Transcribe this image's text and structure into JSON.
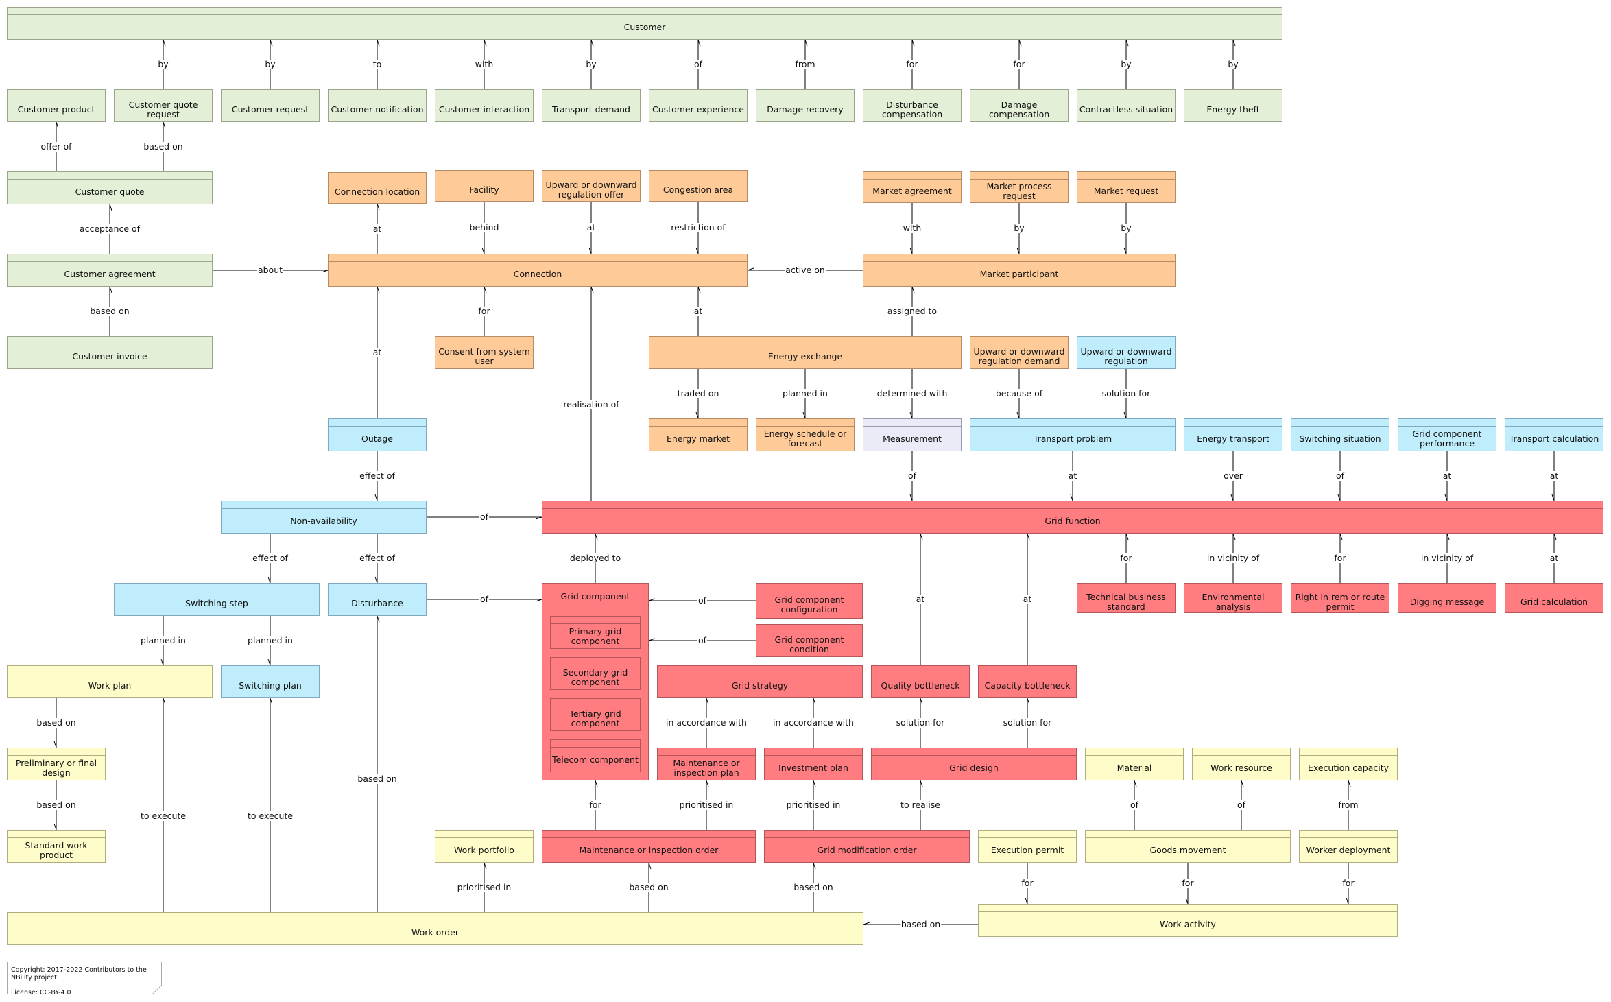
{
  "diagram": {
    "type": "NBility grid operator information model",
    "legend_colors": {
      "customer": "#e3efd6",
      "market": "#fecb98",
      "operations": "#bfedfb",
      "measurement": "#ebebf7",
      "grid": "#ff7d80",
      "work": "#fefdca"
    }
  },
  "entities": {
    "customer": "Customer",
    "customer_product": "Customer product",
    "customer_quote_request": "Customer quote request",
    "customer_request": "Customer request",
    "customer_notification": "Customer notification",
    "customer_interaction": "Customer interaction",
    "transport_demand": "Transport demand",
    "customer_experience": "Customer experience",
    "damage_recovery": "Damage recovery",
    "disturbance_compensation": "Disturbance compensation",
    "damage_compensation": "Damage compensation",
    "contractless_situation": "Contractless situation",
    "energy_theft": "Energy theft",
    "customer_quote": "Customer quote",
    "customer_agreement": "Customer agreement",
    "customer_invoice": "Customer invoice",
    "connection_location": "Connection location",
    "facility": "Facility",
    "regulation_offer": "Upward or downward regulation offer",
    "congestion_area": "Congestion area",
    "market_agreement": "Market agreement",
    "market_process_request": "Market process request",
    "market_request": "Market request",
    "connection": "Connection",
    "market_participant": "Market participant",
    "consent": "Consent from system user",
    "energy_exchange": "Energy exchange",
    "regulation_demand": "Upward or downward regulation demand",
    "regulation": "Upward or downward regulation",
    "outage": "Outage",
    "energy_market": "Energy market",
    "energy_schedule": "Energy schedule or forecast",
    "measurement": "Measurement",
    "transport_problem": "Transport problem",
    "energy_transport": "Energy transport",
    "switching_situation": "Switching situation",
    "grid_component_performance": "Grid component performance",
    "transport_calculation": "Transport calculation",
    "non_availability": "Non-availability",
    "grid_function": "Grid function",
    "switching_step": "Switching step",
    "disturbance": "Disturbance",
    "grid_component": "Grid component",
    "primary_grid_component": "Primary grid component",
    "secondary_grid_component": "Secondary grid component",
    "tertiary_grid_component": "Tertiary grid component",
    "telecom_component": "Telecom component",
    "grid_component_configuration": "Grid component configuration",
    "grid_component_condition": "Grid component condition",
    "technical_business_standard": "Technical business standard",
    "environmental_analysis": "Environmental analysis",
    "right_in_rem": "Right in rem or route permit",
    "digging_message": "Digging message",
    "grid_calculation": "Grid calculation",
    "work_plan": "Work plan",
    "switching_plan": "Switching plan",
    "grid_strategy": "Grid strategy",
    "quality_bottleneck": "Quality bottleneck",
    "capacity_bottleneck": "Capacity bottleneck",
    "preliminary_design": "Preliminary or final design",
    "maintenance_plan": "Maintenance or inspection plan",
    "investment_plan": "Investment plan",
    "grid_design": "Grid design",
    "material": "Material",
    "work_resource": "Work resource",
    "execution_capacity": "Execution capacity",
    "standard_work_product": "Standard work product",
    "work_portfolio": "Work portfolio",
    "maintenance_order": "Maintenance or inspection order",
    "grid_modification_order": "Grid modification order",
    "execution_permit": "Execution permit",
    "goods_movement": "Goods movement",
    "worker_deployment": "Worker deployment",
    "work_order": "Work order",
    "work_activity": "Work activity"
  },
  "relations": [
    {
      "from": "customer_quote_request",
      "to": "customer",
      "label": "by"
    },
    {
      "from": "customer_request",
      "to": "customer",
      "label": "by"
    },
    {
      "from": "customer_notification",
      "to": "customer",
      "label": "to"
    },
    {
      "from": "customer_interaction",
      "to": "customer",
      "label": "with"
    },
    {
      "from": "transport_demand",
      "to": "customer",
      "label": "by"
    },
    {
      "from": "customer_experience",
      "to": "customer",
      "label": "of"
    },
    {
      "from": "damage_recovery",
      "to": "customer",
      "label": "from"
    },
    {
      "from": "disturbance_compensation",
      "to": "customer",
      "label": "for"
    },
    {
      "from": "damage_compensation",
      "to": "customer",
      "label": "for"
    },
    {
      "from": "contractless_situation",
      "to": "customer",
      "label": "by"
    },
    {
      "from": "energy_theft",
      "to": "customer",
      "label": "by"
    },
    {
      "from": "customer_quote",
      "to": "customer_product",
      "label": "offer of"
    },
    {
      "from": "customer_quote",
      "to": "customer_quote_request",
      "label": "based on"
    },
    {
      "from": "customer_agreement",
      "to": "customer_quote",
      "label": "acceptance of"
    },
    {
      "from": "customer_invoice",
      "to": "customer_agreement",
      "label": "based on"
    },
    {
      "from": "customer_agreement",
      "to": "connection",
      "label": "about"
    },
    {
      "from": "connection",
      "to": "connection_location",
      "label": "at"
    },
    {
      "from": "facility",
      "to": "connection",
      "label": "behind"
    },
    {
      "from": "regulation_offer",
      "to": "connection",
      "label": "at"
    },
    {
      "from": "congestion_area",
      "to": "connection",
      "label": "restriction of"
    },
    {
      "from": "market_participant",
      "to": "connection",
      "label": "active on"
    },
    {
      "from": "market_agreement",
      "to": "market_participant",
      "label": "with"
    },
    {
      "from": "market_process_request",
      "to": "market_participant",
      "label": "by"
    },
    {
      "from": "market_request",
      "to": "market_participant",
      "label": "by"
    },
    {
      "from": "outage",
      "to": "connection",
      "label": "at"
    },
    {
      "from": "consent",
      "to": "connection",
      "label": "for"
    },
    {
      "from": "grid_function",
      "to": "connection",
      "label": "realisation of"
    },
    {
      "from": "energy_exchange",
      "to": "connection",
      "label": "at"
    },
    {
      "from": "energy_exchange",
      "to": "market_participant",
      "label": "assigned to"
    },
    {
      "from": "energy_exchange",
      "to": "energy_market",
      "label": "traded on"
    },
    {
      "from": "energy_exchange",
      "to": "energy_schedule",
      "label": "planned in"
    },
    {
      "from": "energy_exchange",
      "to": "measurement",
      "label": "determined with"
    },
    {
      "from": "regulation_demand",
      "to": "transport_problem",
      "label": "because of"
    },
    {
      "from": "regulation",
      "to": "transport_problem",
      "label": "solution for"
    },
    {
      "from": "outage",
      "to": "non_availability",
      "label": "effect of"
    },
    {
      "from": "measurement",
      "to": "grid_function",
      "label": "of"
    },
    {
      "from": "transport_problem",
      "to": "grid_function",
      "label": "at"
    },
    {
      "from": "energy_transport",
      "to": "grid_function",
      "label": "over"
    },
    {
      "from": "switching_situation",
      "to": "grid_function",
      "label": "of"
    },
    {
      "from": "grid_component_performance",
      "to": "grid_function",
      "label": "at"
    },
    {
      "from": "transport_calculation",
      "to": "grid_function",
      "label": "at"
    },
    {
      "from": "non_availability",
      "to": "grid_function",
      "label": "of"
    },
    {
      "from": "non_availability",
      "to": "switching_step",
      "label": "effect of"
    },
    {
      "from": "non_availability",
      "to": "disturbance",
      "label": "effect of"
    },
    {
      "from": "grid_component",
      "to": "grid_function",
      "label": "deployed to"
    },
    {
      "from": "disturbance",
      "to": "grid_component",
      "label": "of"
    },
    {
      "from": "grid_component_configuration",
      "to": "grid_component",
      "label": "of"
    },
    {
      "from": "grid_component_condition",
      "to": "grid_component",
      "label": "of"
    },
    {
      "from": "quality_bottleneck",
      "to": "grid_function",
      "label": "at"
    },
    {
      "from": "capacity_bottleneck",
      "to": "grid_function",
      "label": "at"
    },
    {
      "from": "technical_business_standard",
      "to": "grid_function",
      "label": "for"
    },
    {
      "from": "environmental_analysis",
      "to": "grid_function",
      "label": "in vicinity of"
    },
    {
      "from": "right_in_rem",
      "to": "grid_function",
      "label": "for"
    },
    {
      "from": "digging_message",
      "to": "grid_function",
      "label": "in vicinity of"
    },
    {
      "from": "grid_calculation",
      "to": "grid_function",
      "label": "at"
    },
    {
      "from": "switching_step",
      "to": "work_plan",
      "label": "planned in"
    },
    {
      "from": "switching_step",
      "to": "switching_plan",
      "label": "planned in"
    },
    {
      "from": "work_plan",
      "to": "preliminary_design",
      "label": "based on"
    },
    {
      "from": "preliminary_design",
      "to": "standard_work_product",
      "label": "based on"
    },
    {
      "from": "maintenance_plan",
      "to": "grid_strategy",
      "label": "in accordance with"
    },
    {
      "from": "investment_plan",
      "to": "grid_strategy",
      "label": "in accordance with"
    },
    {
      "from": "grid_design",
      "to": "quality_bottleneck",
      "label": "solution for"
    },
    {
      "from": "grid_design",
      "to": "capacity_bottleneck",
      "label": "solution for"
    },
    {
      "from": "maintenance_order",
      "to": "grid_component",
      "label": "for"
    },
    {
      "from": "maintenance_order",
      "to": "maintenance_plan",
      "label": "prioritised in"
    },
    {
      "from": "grid_modification_order",
      "to": "investment_plan",
      "label": "prioritised in"
    },
    {
      "from": "grid_modification_order",
      "to": "grid_design",
      "label": "to realise"
    },
    {
      "from": "goods_movement",
      "to": "material",
      "label": "of"
    },
    {
      "from": "goods_movement",
      "to": "work_resource",
      "label": "of"
    },
    {
      "from": "worker_deployment",
      "to": "execution_capacity",
      "label": "from"
    },
    {
      "from": "execution_permit",
      "to": "work_activity",
      "label": "for"
    },
    {
      "from": "goods_movement",
      "to": "work_activity",
      "label": "for"
    },
    {
      "from": "worker_deployment",
      "to": "work_activity",
      "label": "for"
    },
    {
      "from": "work_order",
      "to": "work_plan",
      "label": "to execute"
    },
    {
      "from": "work_order",
      "to": "switching_plan",
      "label": "to execute"
    },
    {
      "from": "work_order",
      "to": "disturbance",
      "label": "based on"
    },
    {
      "from": "work_order",
      "to": "work_portfolio",
      "label": "prioritised in"
    },
    {
      "from": "work_order",
      "to": "maintenance_order",
      "label": "based on"
    },
    {
      "from": "work_order",
      "to": "grid_modification_order",
      "label": "based on"
    },
    {
      "from": "work_activity",
      "to": "work_order",
      "label": "based on"
    }
  ],
  "footer": {
    "copyright": "Copyright: 2017-2022 Contributors to the NBility project",
    "license": "License: CC-BY-4.0"
  }
}
